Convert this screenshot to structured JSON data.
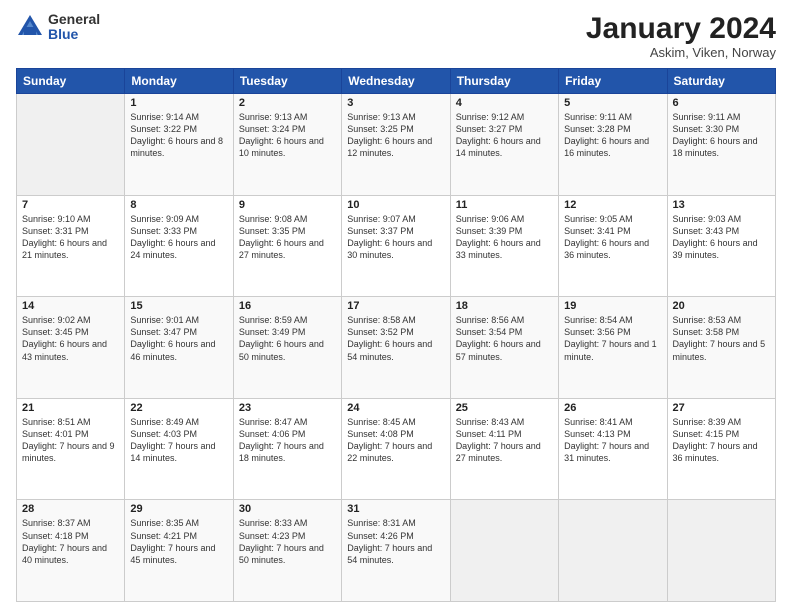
{
  "logo": {
    "general": "General",
    "blue": "Blue"
  },
  "title": "January 2024",
  "location": "Askim, Viken, Norway",
  "days_header": [
    "Sunday",
    "Monday",
    "Tuesday",
    "Wednesday",
    "Thursday",
    "Friday",
    "Saturday"
  ],
  "weeks": [
    [
      {
        "num": "",
        "sunrise": "",
        "sunset": "",
        "daylight": "",
        "empty": true
      },
      {
        "num": "1",
        "sunrise": "Sunrise: 9:14 AM",
        "sunset": "Sunset: 3:22 PM",
        "daylight": "Daylight: 6 hours and 8 minutes."
      },
      {
        "num": "2",
        "sunrise": "Sunrise: 9:13 AM",
        "sunset": "Sunset: 3:24 PM",
        "daylight": "Daylight: 6 hours and 10 minutes."
      },
      {
        "num": "3",
        "sunrise": "Sunrise: 9:13 AM",
        "sunset": "Sunset: 3:25 PM",
        "daylight": "Daylight: 6 hours and 12 minutes."
      },
      {
        "num": "4",
        "sunrise": "Sunrise: 9:12 AM",
        "sunset": "Sunset: 3:27 PM",
        "daylight": "Daylight: 6 hours and 14 minutes."
      },
      {
        "num": "5",
        "sunrise": "Sunrise: 9:11 AM",
        "sunset": "Sunset: 3:28 PM",
        "daylight": "Daylight: 6 hours and 16 minutes."
      },
      {
        "num": "6",
        "sunrise": "Sunrise: 9:11 AM",
        "sunset": "Sunset: 3:30 PM",
        "daylight": "Daylight: 6 hours and 18 minutes."
      }
    ],
    [
      {
        "num": "7",
        "sunrise": "Sunrise: 9:10 AM",
        "sunset": "Sunset: 3:31 PM",
        "daylight": "Daylight: 6 hours and 21 minutes."
      },
      {
        "num": "8",
        "sunrise": "Sunrise: 9:09 AM",
        "sunset": "Sunset: 3:33 PM",
        "daylight": "Daylight: 6 hours and 24 minutes."
      },
      {
        "num": "9",
        "sunrise": "Sunrise: 9:08 AM",
        "sunset": "Sunset: 3:35 PM",
        "daylight": "Daylight: 6 hours and 27 minutes."
      },
      {
        "num": "10",
        "sunrise": "Sunrise: 9:07 AM",
        "sunset": "Sunset: 3:37 PM",
        "daylight": "Daylight: 6 hours and 30 minutes."
      },
      {
        "num": "11",
        "sunrise": "Sunrise: 9:06 AM",
        "sunset": "Sunset: 3:39 PM",
        "daylight": "Daylight: 6 hours and 33 minutes."
      },
      {
        "num": "12",
        "sunrise": "Sunrise: 9:05 AM",
        "sunset": "Sunset: 3:41 PM",
        "daylight": "Daylight: 6 hours and 36 minutes."
      },
      {
        "num": "13",
        "sunrise": "Sunrise: 9:03 AM",
        "sunset": "Sunset: 3:43 PM",
        "daylight": "Daylight: 6 hours and 39 minutes."
      }
    ],
    [
      {
        "num": "14",
        "sunrise": "Sunrise: 9:02 AM",
        "sunset": "Sunset: 3:45 PM",
        "daylight": "Daylight: 6 hours and 43 minutes."
      },
      {
        "num": "15",
        "sunrise": "Sunrise: 9:01 AM",
        "sunset": "Sunset: 3:47 PM",
        "daylight": "Daylight: 6 hours and 46 minutes."
      },
      {
        "num": "16",
        "sunrise": "Sunrise: 8:59 AM",
        "sunset": "Sunset: 3:49 PM",
        "daylight": "Daylight: 6 hours and 50 minutes."
      },
      {
        "num": "17",
        "sunrise": "Sunrise: 8:58 AM",
        "sunset": "Sunset: 3:52 PM",
        "daylight": "Daylight: 6 hours and 54 minutes."
      },
      {
        "num": "18",
        "sunrise": "Sunrise: 8:56 AM",
        "sunset": "Sunset: 3:54 PM",
        "daylight": "Daylight: 6 hours and 57 minutes."
      },
      {
        "num": "19",
        "sunrise": "Sunrise: 8:54 AM",
        "sunset": "Sunset: 3:56 PM",
        "daylight": "Daylight: 7 hours and 1 minute."
      },
      {
        "num": "20",
        "sunrise": "Sunrise: 8:53 AM",
        "sunset": "Sunset: 3:58 PM",
        "daylight": "Daylight: 7 hours and 5 minutes."
      }
    ],
    [
      {
        "num": "21",
        "sunrise": "Sunrise: 8:51 AM",
        "sunset": "Sunset: 4:01 PM",
        "daylight": "Daylight: 7 hours and 9 minutes."
      },
      {
        "num": "22",
        "sunrise": "Sunrise: 8:49 AM",
        "sunset": "Sunset: 4:03 PM",
        "daylight": "Daylight: 7 hours and 14 minutes."
      },
      {
        "num": "23",
        "sunrise": "Sunrise: 8:47 AM",
        "sunset": "Sunset: 4:06 PM",
        "daylight": "Daylight: 7 hours and 18 minutes."
      },
      {
        "num": "24",
        "sunrise": "Sunrise: 8:45 AM",
        "sunset": "Sunset: 4:08 PM",
        "daylight": "Daylight: 7 hours and 22 minutes."
      },
      {
        "num": "25",
        "sunrise": "Sunrise: 8:43 AM",
        "sunset": "Sunset: 4:11 PM",
        "daylight": "Daylight: 7 hours and 27 minutes."
      },
      {
        "num": "26",
        "sunrise": "Sunrise: 8:41 AM",
        "sunset": "Sunset: 4:13 PM",
        "daylight": "Daylight: 7 hours and 31 minutes."
      },
      {
        "num": "27",
        "sunrise": "Sunrise: 8:39 AM",
        "sunset": "Sunset: 4:15 PM",
        "daylight": "Daylight: 7 hours and 36 minutes."
      }
    ],
    [
      {
        "num": "28",
        "sunrise": "Sunrise: 8:37 AM",
        "sunset": "Sunset: 4:18 PM",
        "daylight": "Daylight: 7 hours and 40 minutes."
      },
      {
        "num": "29",
        "sunrise": "Sunrise: 8:35 AM",
        "sunset": "Sunset: 4:21 PM",
        "daylight": "Daylight: 7 hours and 45 minutes."
      },
      {
        "num": "30",
        "sunrise": "Sunrise: 8:33 AM",
        "sunset": "Sunset: 4:23 PM",
        "daylight": "Daylight: 7 hours and 50 minutes."
      },
      {
        "num": "31",
        "sunrise": "Sunrise: 8:31 AM",
        "sunset": "Sunset: 4:26 PM",
        "daylight": "Daylight: 7 hours and 54 minutes."
      },
      {
        "num": "",
        "sunrise": "",
        "sunset": "",
        "daylight": "",
        "empty": true
      },
      {
        "num": "",
        "sunrise": "",
        "sunset": "",
        "daylight": "",
        "empty": true
      },
      {
        "num": "",
        "sunrise": "",
        "sunset": "",
        "daylight": "",
        "empty": true
      }
    ]
  ]
}
